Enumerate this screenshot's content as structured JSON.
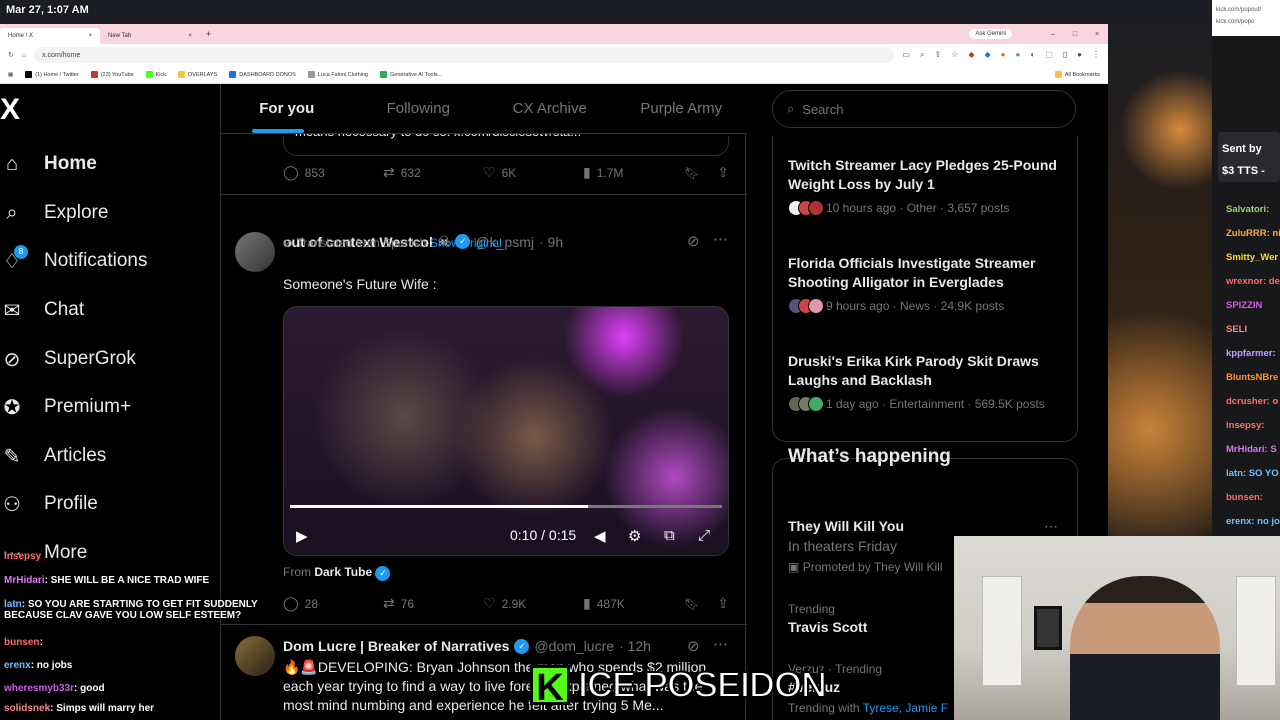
{
  "clock": "Mar 27, 1:07 AM",
  "browser": {
    "tabs": [
      {
        "label": "Home / X"
      },
      {
        "label": "New Tab"
      }
    ],
    "new_tab": "+",
    "ask_gemini": "Ask Gemini",
    "url": "x.com/home",
    "bookmarks": [
      "(1) Home / Twitter",
      "(23) YouTube",
      "Kick",
      "OVERLAYS",
      "DASHBOARD DONOS",
      "Luca Faloni Clothing",
      "Generative AI Tools..."
    ],
    "all_bookmarks": "All Bookmarks"
  },
  "nav": {
    "logo": "X",
    "items": [
      {
        "label": "Home",
        "icon": "home-icon"
      },
      {
        "label": "Explore",
        "icon": "search-icon"
      },
      {
        "label": "Notifications",
        "icon": "bell-icon",
        "badge": "8"
      },
      {
        "label": "Chat",
        "icon": "mail-icon"
      },
      {
        "label": "SuperGrok",
        "icon": "grok-icon"
      },
      {
        "label": "Premium+",
        "icon": "verified-icon"
      },
      {
        "label": "Articles",
        "icon": "article-icon"
      },
      {
        "label": "Profile",
        "icon": "person-icon"
      },
      {
        "label": "More",
        "icon": "more-icon"
      }
    ]
  },
  "feed": {
    "tabs": [
      "For you",
      "Following",
      "CX Archive",
      "Purple Army"
    ],
    "prev_cut_text": "means necessary to do so. x.com/disclosetv/sta...",
    "prev_stats": {
      "replies": "853",
      "reposts": "632",
      "likes": "6K",
      "views": "1.7M"
    },
    "post1": {
      "name": "out of context Westcol",
      "handle": "@k_psmj",
      "time": "· 9h",
      "translated": "Translated from Spanish",
      "show_original": "Show original",
      "text": "Someone's Future Wife :",
      "video_time": "0:10 / 0:15",
      "video_progress": 0.69,
      "from_label": "From",
      "from_source": "Dark Tube",
      "stats": {
        "replies": "28",
        "reposts": "76",
        "likes": "2.9K",
        "views": "487K"
      }
    },
    "post2": {
      "name": "Dom Lucre | Breaker of Narratives",
      "handle": "@dom_lucre",
      "time": "· 12h",
      "text": "🔥🚨DEVELOPING: Bryan Johnson the man who spends $2 million each year trying to find a way to live forever explained what was the most mind numbing and experience he felt after trying 5 Me..."
    }
  },
  "right": {
    "search_placeholder": "Search",
    "news": [
      {
        "title": "Twitch Streamer Lacy Pledges 25-Pound Weight Loss by July 1",
        "meta": "10 hours ago · Other · 3,657 posts"
      },
      {
        "title": "Florida Officials Investigate Streamer Shooting Alligator in Everglades",
        "meta": "9 hours ago · News · 24.9K posts"
      },
      {
        "title": "Druski's Erika Kirk Parody Skit Draws Laughs and Backlash",
        "meta": "1 day ago · Entertainment · 569.5K posts"
      }
    ],
    "whats_happening": "What’s happening",
    "promo": {
      "title": "They Will Kill You",
      "sub": "In theaters Friday",
      "promoted": "Promoted by They Will Kill"
    },
    "trends": [
      {
        "category": "Trending",
        "name": "Travis Scott"
      },
      {
        "category": "Verzuz · Trending",
        "name": "#Verzuz",
        "with_label": "Trending with",
        "with": "Tyrese, Jamie F"
      }
    ]
  },
  "stream": {
    "kick_url": "kick.com/popout/ kick.com/popo",
    "tts_sender": "Sent by",
    "tts_amount": "$3 TTS -",
    "side_chat": [
      {
        "user": "Salvatori:",
        "color": "#9ad36a"
      },
      {
        "user": "ZuluRRR: ni",
        "color": "#ffa94d"
      },
      {
        "user": "Smitty_Wer",
        "color": "#ffd43b"
      },
      {
        "user": "wrexnor: de",
        "color": "#ff6b6b"
      },
      {
        "user": "SPIZZIN",
        "color": "#cc5de8"
      },
      {
        "user": "SELI",
        "color": "#ff8787"
      },
      {
        "user": "kppfarmer:",
        "color": "#c0a0ff"
      },
      {
        "user": "BluntsNBre",
        "color": "#ff922b"
      },
      {
        "user": "dcrusher: o",
        "color": "#ff6b6b"
      },
      {
        "user": "insepsy:",
        "color": "#ff6b6b"
      },
      {
        "user": "MrHidari: S",
        "color": "#da77f2"
      },
      {
        "user": "latn: SO YO",
        "color": "#74c0fc"
      },
      {
        "user": "bunsen:",
        "color": "#ff6b6b"
      },
      {
        "user": "erenx: no jo",
        "color": "#74c0fc"
      }
    ],
    "overlay_chat": [
      {
        "user": "insepsy",
        "msg": "",
        "color": "#ff6b6b"
      },
      {
        "user": "MrHidari",
        "msg": ": SHE WILL BE A NICE TRAD WIFE",
        "color": "#da77f2"
      },
      {
        "user": "latn",
        "msg": ": SO YOU ARE STARTING TO GET FIT SUDDENLY BECAUSE CLAV GAVE YOU LOW SELF ESTEEM?",
        "color": "#74c0fc"
      },
      {
        "user": "bunsen",
        "msg": ":",
        "color": "#ff6b6b"
      },
      {
        "user": "erenx",
        "msg": ": no jobs",
        "color": "#74c0fc"
      },
      {
        "user": "wheresmyb33r",
        "msg": ": good",
        "color": "#cc5de8"
      },
      {
        "user": "solidsnek",
        "msg": ": Simps will marry her",
        "color": "#ff8787"
      }
    ],
    "brand_k": "K",
    "brand_name": "ICE POSEIDON"
  }
}
